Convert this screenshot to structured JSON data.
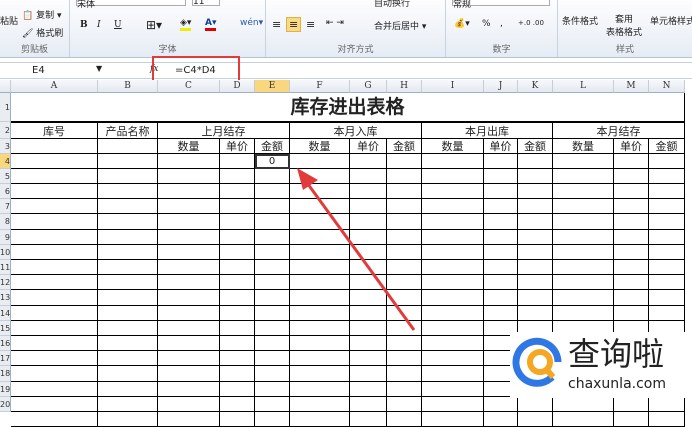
{
  "ribbon": {
    "clipboard": {
      "paste": "粘贴",
      "copy": "复制",
      "format_painter": "格式刷",
      "label": "剪贴板"
    },
    "font": {
      "name": "宋体",
      "size": "11",
      "bold": "B",
      "italic": "I",
      "underline": "U",
      "label": "字体"
    },
    "alignment": {
      "wrap": "自动换行",
      "merge": "合并后居中",
      "label": "对齐方式"
    },
    "number": {
      "format": "常规",
      "percent": "%",
      "comma": ",",
      "label": "数字"
    },
    "styles": {
      "conditional": "条件格式",
      "table": "套用\n表格格式",
      "cell": "单元格样式",
      "label": "样式"
    }
  },
  "formula_bar": {
    "name_box": "E4",
    "fx": "fx",
    "formula": "=C4*D4"
  },
  "columns": [
    "A",
    "B",
    "C",
    "D",
    "E",
    "F",
    "G",
    "H",
    "I",
    "J",
    "K",
    "L",
    "M",
    "N"
  ],
  "active_column": "E",
  "row_numbers": [
    "1",
    "2",
    "3",
    "4",
    "5",
    "6",
    "7",
    "8",
    "9",
    "10",
    "11",
    "12",
    "13",
    "14",
    "15",
    "16",
    "17",
    "18",
    "19",
    "20"
  ],
  "sheet": {
    "title": "库存进出表格",
    "headers": [
      "库号",
      "产品名称",
      "上月结存",
      "本月入库",
      "本月出库",
      "本月结存"
    ],
    "subheaders": [
      "数量",
      "单价",
      "金额",
      "数量",
      "单价",
      "金额",
      "数量",
      "单价",
      "金额",
      "数量",
      "单价",
      "金额"
    ],
    "selected_cell": {
      "ref": "E4",
      "value": "0"
    }
  },
  "watermark": {
    "name": "查询啦",
    "url": "chaxunla.com"
  },
  "colors": {
    "accent_red": "#e23b3b",
    "selection": "#f9d77e"
  }
}
